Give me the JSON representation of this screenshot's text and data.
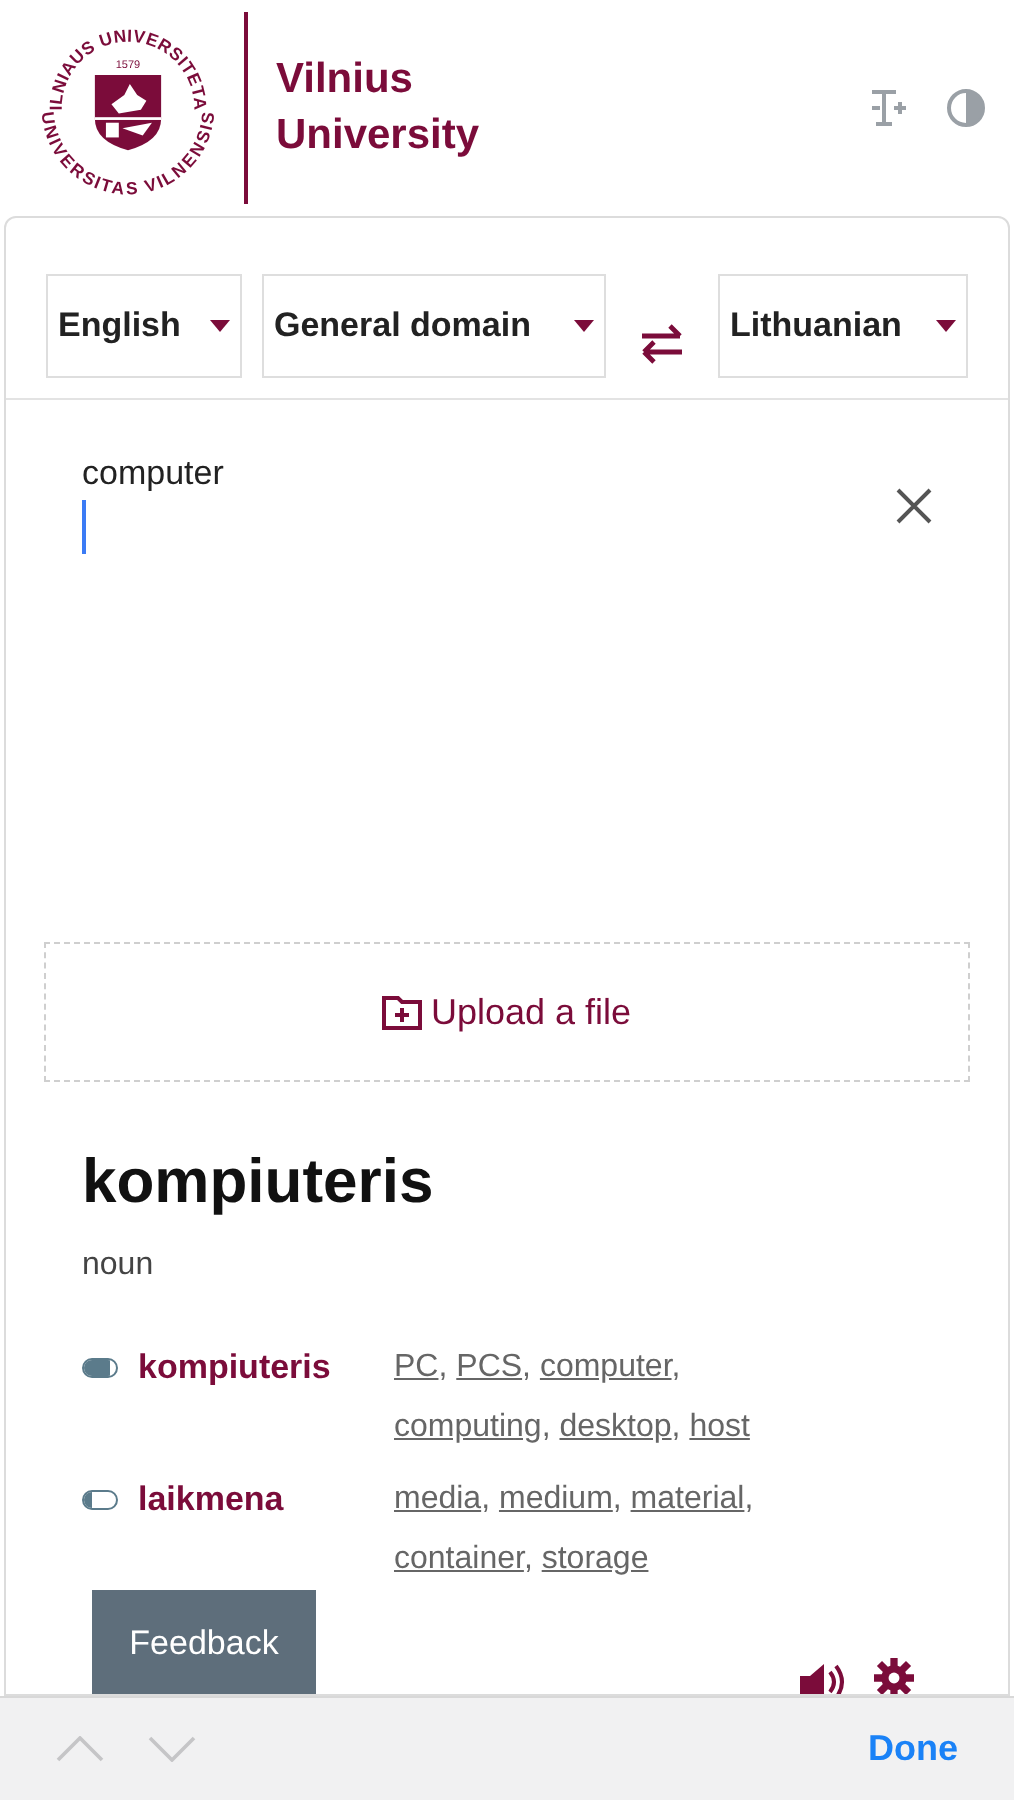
{
  "logo": {
    "top_arc": "VILNIAUS UNIVERSITETAS",
    "year": "1579",
    "bottom_arc": "UNIVERSITAS VILNENSIS"
  },
  "brand": [
    "Vilnius",
    "University"
  ],
  "selectors": {
    "source": "English",
    "domain": "General domain",
    "target": "Lithuanian"
  },
  "input": {
    "value": "computer"
  },
  "upload": {
    "label": "Upload a file"
  },
  "result": {
    "headword": "kompiuteris",
    "pos": "noun",
    "separator": ",",
    "translations": [
      {
        "term": "kompiuteris",
        "level": 0.8,
        "back": [
          "PC",
          "PCS",
          "computer",
          "computing",
          "desktop",
          "host"
        ]
      },
      {
        "term": "laikmena",
        "level": 0.25,
        "back": [
          "media",
          "medium",
          "material",
          "container",
          "storage"
        ]
      }
    ]
  },
  "feedback": "Feedback",
  "keyboard_bar": {
    "done": "Done"
  }
}
